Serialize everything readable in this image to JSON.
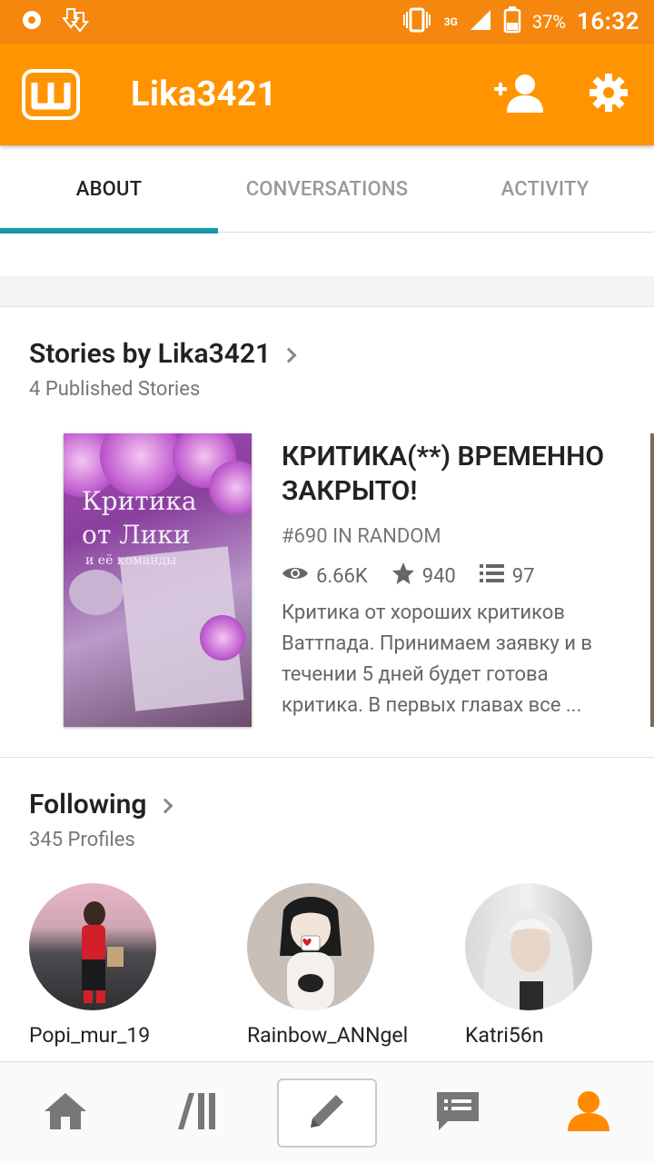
{
  "status_bar": {
    "battery": "37%",
    "time": "16:32",
    "network": "3G",
    "icons": [
      "notification-dot-icon",
      "download-icon",
      "vibrate-icon",
      "signal-icon",
      "battery-icon"
    ]
  },
  "app_bar": {
    "title": "Lika3421",
    "logo_letter": "Ш",
    "icons": [
      "wattpad-logo-icon",
      "add-friend-icon",
      "gear-icon"
    ]
  },
  "tabs": [
    {
      "label": "ABOUT",
      "active": true
    },
    {
      "label": "CONVERSATIONS",
      "active": false
    },
    {
      "label": "ACTIVITY",
      "active": false
    }
  ],
  "stories": {
    "title": "Stories by Lika3421",
    "subtitle": "4 Published Stories",
    "items": [
      {
        "title": "КРИТИКА(**) ВРЕМЕННО ЗАКРЫТО!",
        "rank": "#690 IN RANDOM",
        "reads": "6.66K",
        "votes": "940",
        "parts": "97",
        "description": "Критика от хороших критиков Ваттпада. Принимаем заявку и в течении 5 дней будет готова критика. В первых главах все ...",
        "cover_text": [
          "Критика",
          "от Лики",
          "и её команды"
        ]
      }
    ]
  },
  "following": {
    "title": "Following",
    "subtitle": "345 Profiles",
    "profiles": [
      {
        "name": "Popi_mur_19"
      },
      {
        "name": "Rainbow_ANNgel"
      },
      {
        "name": "Katri56n"
      }
    ]
  },
  "bottom_nav": {
    "items": [
      "home-icon",
      "library-icon",
      "pencil-icon",
      "messages-icon",
      "profile-icon"
    ],
    "active": "profile-icon"
  },
  "colors": {
    "status_bar": "#f5870e",
    "app_bar": "#ff9400",
    "tab_indicator": "#1a98a8",
    "nav_active": "#ff8a00",
    "nav_inactive": "#777777"
  }
}
